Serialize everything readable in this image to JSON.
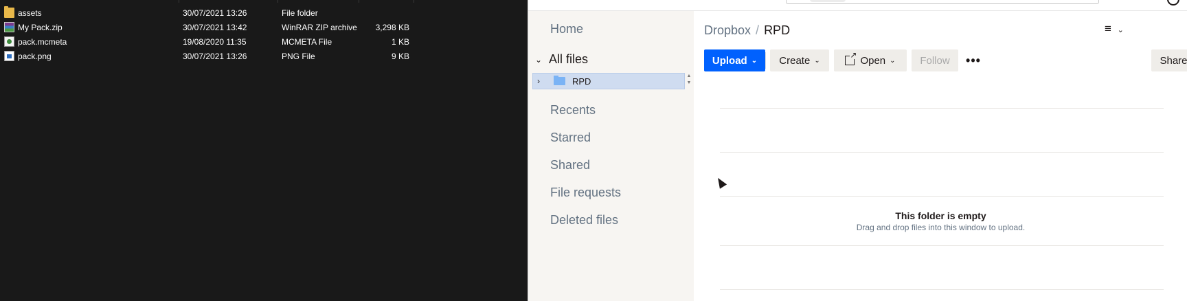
{
  "explorer": {
    "files": [
      {
        "name": "assets",
        "date": "30/07/2021 13:26",
        "type": "File folder",
        "size": "",
        "icon": "folder-icon"
      },
      {
        "name": "My Pack.zip",
        "date": "30/07/2021 13:42",
        "type": "WinRAR ZIP archive",
        "size": "3,298 KB",
        "icon": "zip-archive-icon"
      },
      {
        "name": "pack.mcmeta",
        "date": "19/08/2020 11:35",
        "type": "MCMETA File",
        "size": "1 KB",
        "icon": "mcmeta-file-icon"
      },
      {
        "name": "pack.png",
        "date": "30/07/2021 13:26",
        "type": "PNG File",
        "size": "9 KB",
        "icon": "png-file-icon"
      }
    ]
  },
  "dropbox": {
    "sidebar": {
      "home": "Home",
      "all_files": "All files",
      "tree_folder": "RPD",
      "recents": "Recents",
      "starred": "Starred",
      "shared": "Shared",
      "file_requests": "File requests",
      "deleted_files": "Deleted files"
    },
    "breadcrumb": {
      "root": "Dropbox",
      "separator": "/",
      "current": "RPD"
    },
    "toolbar": {
      "upload": "Upload",
      "create": "Create",
      "open": "Open",
      "follow": "Follow",
      "more": "•••",
      "share": "Share"
    },
    "empty_state": {
      "title": "This folder is empty",
      "subtitle": "Drag and drop files into this window to upload."
    },
    "colors": {
      "accent": "#0061fe",
      "sidebar_bg": "#f7f5f2",
      "selected_row": "#cfdcf0"
    }
  }
}
